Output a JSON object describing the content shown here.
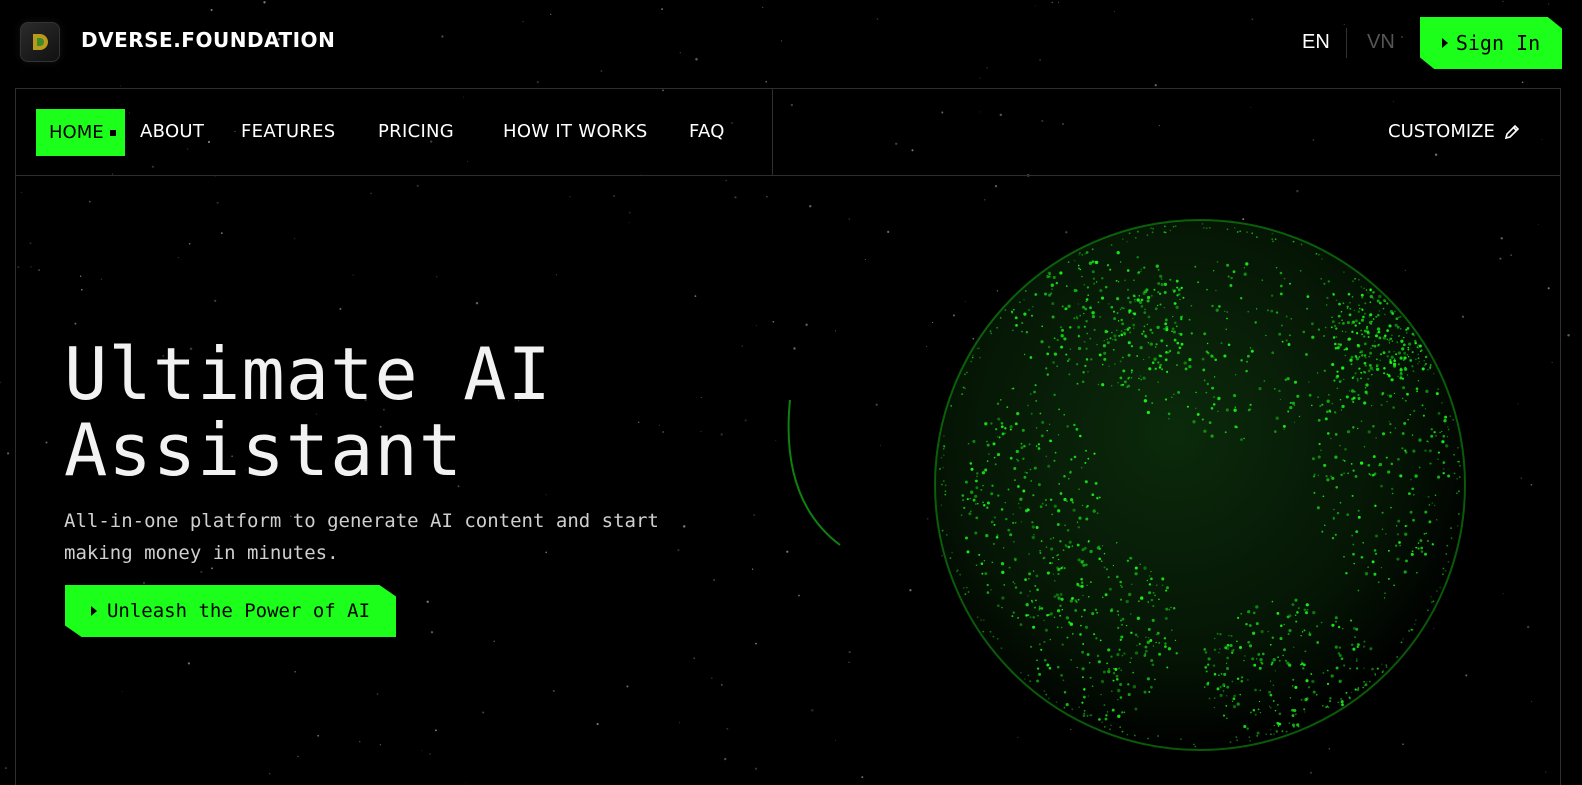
{
  "brand": {
    "name": "DVERSE.FOUNDATION",
    "logo_letter": "D"
  },
  "header": {
    "lang_en": "EN",
    "lang_vn": "VN",
    "signin_label": "Sign In"
  },
  "nav": {
    "items": [
      {
        "label": "HOME",
        "active": true
      },
      {
        "label": "ABOUT"
      },
      {
        "label": "FEATURES"
      },
      {
        "label": "PRICING"
      },
      {
        "label": "HOW IT WORKS"
      },
      {
        "label": "FAQ"
      }
    ],
    "customize_label": "CUSTOMIZE"
  },
  "hero": {
    "title_line1": "Ultimate AI",
    "title_line2": "Assistant",
    "subtitle_line1": "All-in-one platform to generate AI content and start",
    "subtitle_line2": "making money in minutes.",
    "cta_label": "Unleash the Power of AI"
  },
  "colors": {
    "accent": "#1bff1b",
    "background": "#000000",
    "border": "#2e2e2e"
  },
  "icons": {
    "customize": "pencil-icon",
    "cta": "play-triangle-icon"
  }
}
